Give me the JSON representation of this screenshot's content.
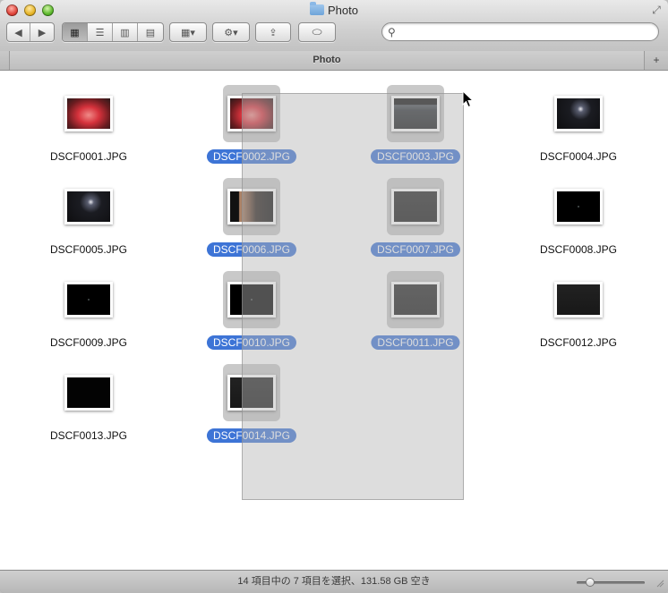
{
  "window": {
    "title": "Photo"
  },
  "toolbar": {
    "back_glyph": "◀",
    "forward_glyph": "▶",
    "views": [
      {
        "name": "icon-view",
        "glyph": "▦",
        "active": true
      },
      {
        "name": "list-view",
        "glyph": "☰",
        "active": false
      },
      {
        "name": "column-view",
        "glyph": "▥",
        "active": false
      },
      {
        "name": "coverflow-view",
        "glyph": "▤",
        "active": false
      }
    ],
    "arrange_glyph": "▦▾",
    "action_glyph": "⚙▾",
    "share_glyph": "⇪",
    "tag_glyph": "⬭",
    "fullscreen_glyph": "⤢"
  },
  "search": {
    "placeholder": "",
    "value": ""
  },
  "pathbar": {
    "label": "Photo",
    "add_glyph": "+"
  },
  "files": [
    {
      "name": "DSCF0001.JPG",
      "selected": false,
      "thumb": "red-face"
    },
    {
      "name": "DSCF0002.JPG",
      "selected": true,
      "thumb": "red-face"
    },
    {
      "name": "DSCF0003.JPG",
      "selected": true,
      "thumb": "night-lamp"
    },
    {
      "name": "DSCF0004.JPG",
      "selected": false,
      "thumb": "night-glow"
    },
    {
      "name": "DSCF0005.JPG",
      "selected": false,
      "thumb": "night-glow"
    },
    {
      "name": "DSCF0006.JPG",
      "selected": true,
      "thumb": "window-dark"
    },
    {
      "name": "DSCF0007.JPG",
      "selected": true,
      "thumb": "dark"
    },
    {
      "name": "DSCF0008.JPG",
      "selected": false,
      "thumb": "black-dot"
    },
    {
      "name": "DSCF0009.JPG",
      "selected": false,
      "thumb": "black-dot"
    },
    {
      "name": "DSCF0010.JPG",
      "selected": true,
      "thumb": "black-dot"
    },
    {
      "name": "DSCF0011.JPG",
      "selected": true,
      "thumb": "dark"
    },
    {
      "name": "DSCF0012.JPG",
      "selected": false,
      "thumb": "dark"
    },
    {
      "name": "DSCF0013.JPG",
      "selected": false,
      "thumb": "black"
    },
    {
      "name": "DSCF0014.JPG",
      "selected": true,
      "thumb": "dark"
    }
  ],
  "status": {
    "text": "14 項目中の 7 項目を選択、131.58 GB 空き"
  },
  "icon_size_slider": {
    "value": 0.15
  },
  "colors": {
    "selection": "#3d74d6",
    "selection_bg": "#c9c9c9"
  }
}
